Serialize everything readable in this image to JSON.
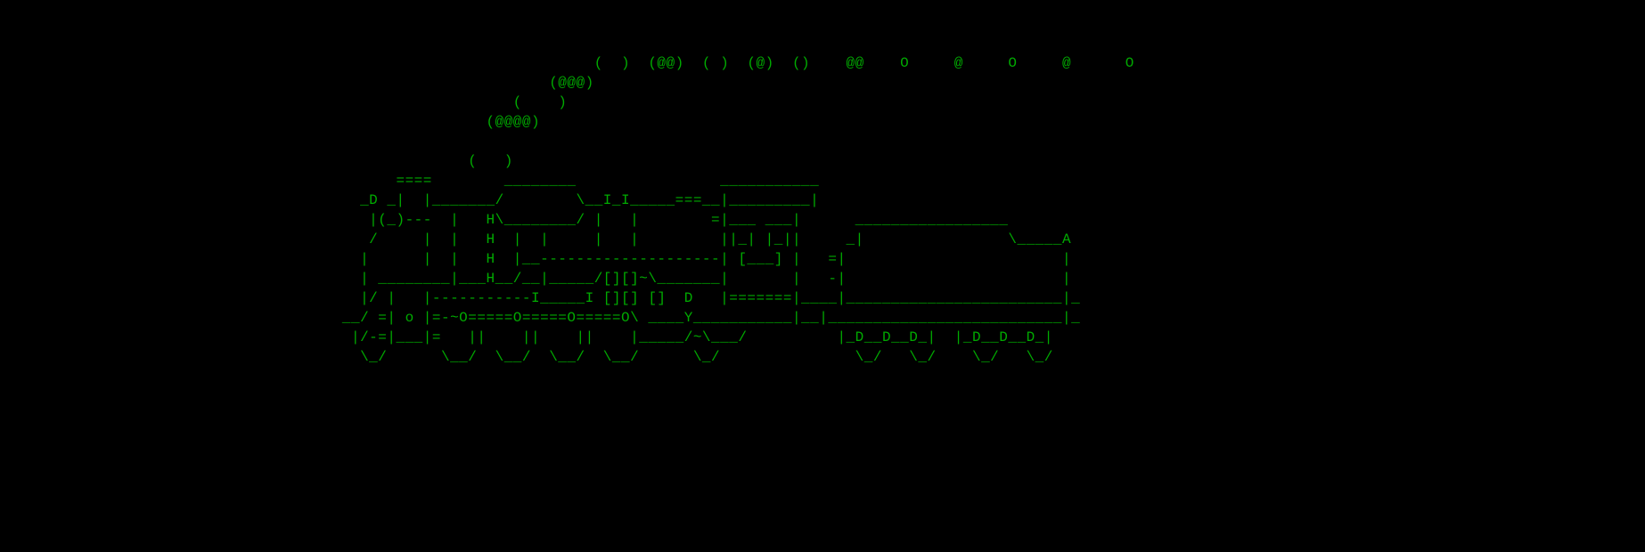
{
  "terminal": {
    "foreground_color": "#00aa00",
    "background_color": "#000000",
    "program": "sl",
    "description": "Steam Locomotive ASCII art animation (sl command)",
    "ascii_lines": [
      "                                                                  (  )  (@@)  ( )  (@)  ()    @@    O     @     O     @      O",
      "                                                             (@@@)",
      "                                                         (    )",
      "                                                      (@@@@)",
      "",
      "                                                    (   )",
      "                                            ====        ________                ___________",
      "                                        _D _|  |_______/        \\__I_I_____===__|_________|",
      "                                         |(_)---  |   H\\________/ |   |        =|___ ___|      _________________",
      "                                         /     |  |   H  |  |     |   |         ||_| |_||     _|                \\_____A",
      "                                        |      |  |   H  |__--------------------| [___] |   =|                        |",
      "                                        | ________|___H__/__|_____/[][]~\\_______|       |   -|                        |",
      "                                        |/ |   |-----------I_____I [][] []  D   |=======|____|________________________|_",
      "                                      __/ =| o |=-~O=====O=====O=====O\\ ____Y___________|__|__________________________|_",
      "                                       |/-=|___|=   ||    ||    ||    |_____/~\\___/          |_D__D__D_|  |_D__D__D_|",
      "                                        \\_/      \\__/  \\__/  \\__/  \\__/      \\_/               \\_/   \\_/    \\_/   \\_/"
    ]
  }
}
